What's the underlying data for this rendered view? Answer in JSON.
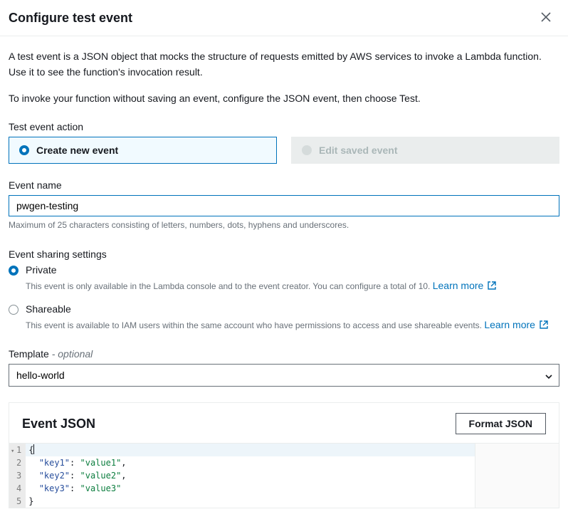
{
  "header": {
    "title": "Configure test event"
  },
  "intro": "A test event is a JSON object that mocks the structure of requests emitted by AWS services to invoke a Lambda function. Use it to see the function's invocation result.",
  "subintro": "To invoke your function without saving an event, configure the JSON event, then choose Test.",
  "action": {
    "label": "Test event action",
    "create_label": "Create new event",
    "edit_label": "Edit saved event",
    "selected": "create"
  },
  "event_name": {
    "label": "Event name",
    "value": "pwgen-testing",
    "hint": "Maximum of 25 characters consisting of letters, numbers, dots, hyphens and underscores."
  },
  "sharing": {
    "label": "Event sharing settings",
    "private": {
      "label": "Private",
      "desc": "This event is only available in the Lambda console and to the event creator. You can configure a total of 10.",
      "learn_more": "Learn more"
    },
    "shareable": {
      "label": "Shareable",
      "desc": "This event is available to IAM users within the same account who have permissions to access and use shareable events.",
      "learn_more": "Learn more"
    },
    "selected": "private"
  },
  "template": {
    "label": "Template",
    "optional_tag": "- optional",
    "value": "hello-world"
  },
  "json": {
    "title": "Event JSON",
    "format_btn": "Format JSON",
    "lines": [
      "{",
      "  \"key1\": \"value1\",",
      "  \"key2\": \"value2\",",
      "  \"key3\": \"value3\"",
      "}"
    ]
  }
}
